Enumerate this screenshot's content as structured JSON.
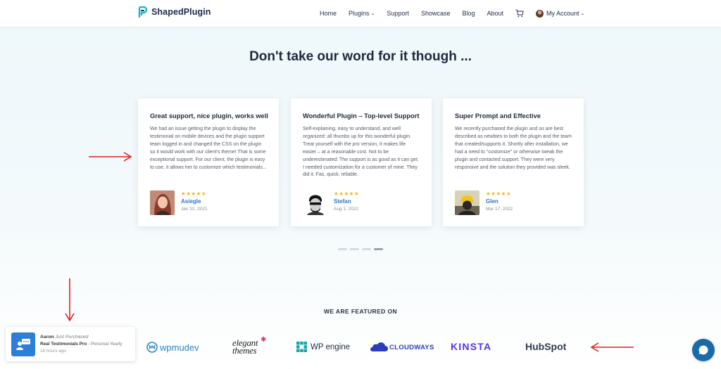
{
  "header": {
    "logo_text": "ShapedPlugin",
    "nav": [
      {
        "label": "Home",
        "has_caret": false
      },
      {
        "label": "Plugins",
        "has_caret": true
      },
      {
        "label": "Support",
        "has_caret": false
      },
      {
        "label": "Showcase",
        "has_caret": false
      },
      {
        "label": "Blog",
        "has_caret": false
      },
      {
        "label": "About",
        "has_caret": false
      }
    ],
    "account_label": "My Account"
  },
  "section_title": "Don't take our word for it though ...",
  "testimonials": [
    {
      "title": "Great support, nice plugin, works well",
      "text": "We had an issue getting the plugin to display the testimonial on mobile devices and the plugin support team logged in and changed the CSS on the plugin so it would work with our client's theme! That is some exceptional support. For our client, the plugin is easy to use, it allows her to customize which testimonials...",
      "stars": "★★★★★",
      "name": "Asiegle",
      "date": "Jan 22, 2021"
    },
    {
      "title": "Wonderful Plugin – Top-level Support",
      "text": "Self-explaining, easy to understand, and well organized: all thumbs up for this wonderful plugin. Treat yourself with the pro version, it makes life easier – at a reasonable cost. Not to be underestimated: The support is as good as it can get. I needed customization for a customer of mine. They did it. Fas, quick, reliable.",
      "stars": "★★★★★",
      "name": "Stefan",
      "date": "Aug 1, 2022"
    },
    {
      "title": "Super Prompt and Effective",
      "text": "We recently purchased the plugin and so are best described as newbies to both the plugin and the team that created/supports it. Shortly after installation, we had a need to \"customize\" or otherwise tweak the plugin and contacted support. They were very responsive and the solution they provided was sleek.",
      "stars": "★★★★★",
      "name": "Glen",
      "date": "Mar 17, 2022"
    }
  ],
  "carousel": {
    "total_dots": 4,
    "active_dot": 4
  },
  "featured": {
    "title": "WE ARE FEATURED ON",
    "brands": [
      "wpmudev",
      "elegant themes",
      "WP engine",
      "CLOUDWAYS",
      "KINSTA",
      "HubSpot"
    ]
  },
  "notification": {
    "name": "Aaron",
    "status": "Just Purchased",
    "product": "Real Testimonials Pro",
    "plan": " - Personal Yearly",
    "time": "18 hours ago"
  },
  "colors": {
    "accent": "#2f76c9",
    "star": "#f6b21b",
    "arrow_red": "#e02020",
    "chat": "#1a6aa8"
  }
}
